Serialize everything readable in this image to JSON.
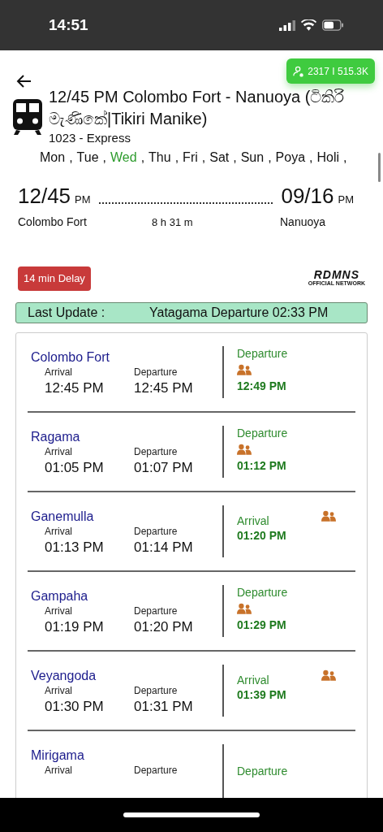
{
  "status_bar": {
    "time": "14:51"
  },
  "views_badge": "2317 I 515.3K",
  "train": {
    "title": "12/45 PM Colombo Fort - Nanuoya (ටිකිරි මැණිකේ|Tikiri Manike)",
    "number": "1023 - Express",
    "day_separator": ",",
    "days": [
      {
        "label": "Mon",
        "selected": false
      },
      {
        "label": "Tue",
        "selected": false
      },
      {
        "label": "Wed",
        "selected": true
      },
      {
        "label": "Thu",
        "selected": false
      },
      {
        "label": "Fri",
        "selected": false
      },
      {
        "label": "Sat",
        "selected": false
      },
      {
        "label": "Sun",
        "selected": false
      },
      {
        "label": "Poya",
        "selected": false
      },
      {
        "label": "Holi",
        "selected": false
      }
    ]
  },
  "journey": {
    "start_time": "12/45",
    "start_suffix": "PM",
    "start_station": "Colombo Fort",
    "duration": "8 h 31 m",
    "end_time": "09/16",
    "end_suffix": "PM",
    "end_station": "Nanuoya"
  },
  "delay": "14 min Delay",
  "logo": {
    "name": "RDMNS",
    "tagline": "OFFICIAL NETWORK"
  },
  "last_update": {
    "label": "Last Update :",
    "value": "Yatagama Departure 02:33 PM"
  },
  "stops": [
    {
      "station": "Colombo Fort",
      "arrival_label": "Arrival",
      "arrival": "12:45 PM",
      "departure_label": "Departure",
      "departure": "12:45 PM",
      "kind": "departure",
      "status": "Departure",
      "actual": "12:49 PM"
    },
    {
      "station": "Ragama",
      "arrival_label": "Arrival",
      "arrival": "01:05 PM",
      "departure_label": "Departure",
      "departure": "01:07 PM",
      "kind": "departure",
      "status": "Departure",
      "actual": "01:12 PM"
    },
    {
      "station": "Ganemulla",
      "arrival_label": "Arrival",
      "arrival": "01:13 PM",
      "departure_label": "Departure",
      "departure": "01:14 PM",
      "kind": "arrival",
      "status": "Arrival",
      "actual": "01:20 PM"
    },
    {
      "station": "Gampaha",
      "arrival_label": "Arrival",
      "arrival": "01:19 PM",
      "departure_label": "Departure",
      "departure": "01:20 PM",
      "kind": "departure",
      "status": "Departure",
      "actual": "01:29 PM"
    },
    {
      "station": "Veyangoda",
      "arrival_label": "Arrival",
      "arrival": "01:30 PM",
      "departure_label": "Departure",
      "departure": "01:31 PM",
      "kind": "arrival",
      "status": "Arrival",
      "actual": "01:39 PM"
    },
    {
      "station": "Mirigama",
      "arrival_label": "Arrival",
      "departure_label": "Departure",
      "kind": "departure",
      "status": "Departure"
    }
  ]
}
